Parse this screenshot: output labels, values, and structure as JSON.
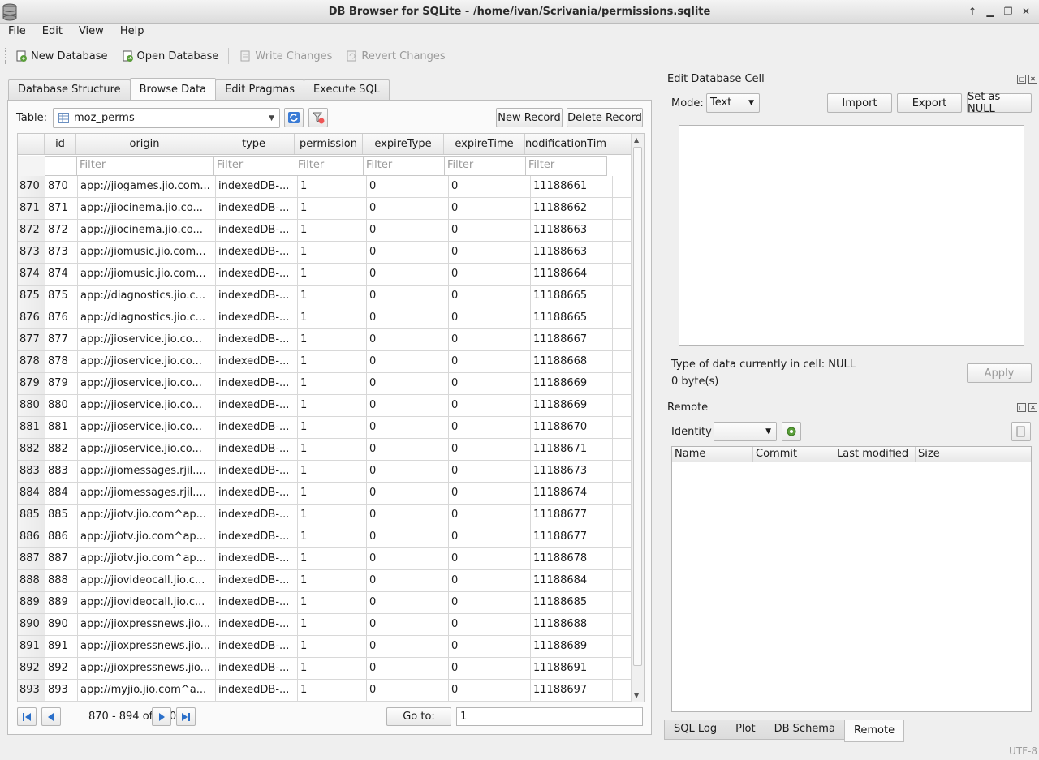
{
  "window": {
    "title": "DB Browser for SQLite - /home/ivan/Scrivania/permissions.sqlite"
  },
  "menu": [
    "File",
    "Edit",
    "View",
    "Help"
  ],
  "toolbar": {
    "new_db": "New Database",
    "open_db": "Open Database",
    "write": "Write Changes",
    "revert": "Revert Changes"
  },
  "tabs": [
    "Database Structure",
    "Browse Data",
    "Edit Pragmas",
    "Execute SQL"
  ],
  "browse": {
    "table_label": "Table:",
    "table_value": "moz_perms",
    "new_record": "New Record",
    "delete_record": "Delete Record",
    "columns": [
      "id",
      "origin",
      "type",
      "permission",
      "expireType",
      "expireTime",
      "nodificationTim"
    ],
    "filter_placeholder": "Filter",
    "rows": [
      [
        "870",
        "870",
        "app://jiogames.jio.com...",
        "indexedDB-...",
        "1",
        "0",
        "0",
        "11188661"
      ],
      [
        "871",
        "871",
        "app://jiocinema.jio.co...",
        "indexedDB-...",
        "1",
        "0",
        "0",
        "11188662"
      ],
      [
        "872",
        "872",
        "app://jiocinema.jio.co...",
        "indexedDB-...",
        "1",
        "0",
        "0",
        "11188663"
      ],
      [
        "873",
        "873",
        "app://jiomusic.jio.com...",
        "indexedDB-...",
        "1",
        "0",
        "0",
        "11188663"
      ],
      [
        "874",
        "874",
        "app://jiomusic.jio.com...",
        "indexedDB-...",
        "1",
        "0",
        "0",
        "11188664"
      ],
      [
        "875",
        "875",
        "app://diagnostics.jio.c...",
        "indexedDB-...",
        "1",
        "0",
        "0",
        "11188665"
      ],
      [
        "876",
        "876",
        "app://diagnostics.jio.c...",
        "indexedDB-...",
        "1",
        "0",
        "0",
        "11188665"
      ],
      [
        "877",
        "877",
        "app://jioservice.jio.co...",
        "indexedDB-...",
        "1",
        "0",
        "0",
        "11188667"
      ],
      [
        "878",
        "878",
        "app://jioservice.jio.co...",
        "indexedDB-...",
        "1",
        "0",
        "0",
        "11188668"
      ],
      [
        "879",
        "879",
        "app://jioservice.jio.co...",
        "indexedDB-...",
        "1",
        "0",
        "0",
        "11188669"
      ],
      [
        "880",
        "880",
        "app://jioservice.jio.co...",
        "indexedDB-...",
        "1",
        "0",
        "0",
        "11188669"
      ],
      [
        "881",
        "881",
        "app://jioservice.jio.co...",
        "indexedDB-...",
        "1",
        "0",
        "0",
        "11188670"
      ],
      [
        "882",
        "882",
        "app://jioservice.jio.co...",
        "indexedDB-...",
        "1",
        "0",
        "0",
        "11188671"
      ],
      [
        "883",
        "883",
        "app://jiomessages.rjil....",
        "indexedDB-...",
        "1",
        "0",
        "0",
        "11188673"
      ],
      [
        "884",
        "884",
        "app://jiomessages.rjil....",
        "indexedDB-...",
        "1",
        "0",
        "0",
        "11188674"
      ],
      [
        "885",
        "885",
        "app://jiotv.jio.com^ap...",
        "indexedDB-...",
        "1",
        "0",
        "0",
        "11188677"
      ],
      [
        "886",
        "886",
        "app://jiotv.jio.com^ap...",
        "indexedDB-...",
        "1",
        "0",
        "0",
        "11188677"
      ],
      [
        "887",
        "887",
        "app://jiotv.jio.com^ap...",
        "indexedDB-...",
        "1",
        "0",
        "0",
        "11188678"
      ],
      [
        "888",
        "888",
        "app://jiovideocall.jio.c...",
        "indexedDB-...",
        "1",
        "0",
        "0",
        "11188684"
      ],
      [
        "889",
        "889",
        "app://jiovideocall.jio.c...",
        "indexedDB-...",
        "1",
        "0",
        "0",
        "11188685"
      ],
      [
        "890",
        "890",
        "app://jioxpressnews.jio...",
        "indexedDB-...",
        "1",
        "0",
        "0",
        "11188688"
      ],
      [
        "891",
        "891",
        "app://jioxpressnews.jio...",
        "indexedDB-...",
        "1",
        "0",
        "0",
        "11188689"
      ],
      [
        "892",
        "892",
        "app://jioxpressnews.jio...",
        "indexedDB-...",
        "1",
        "0",
        "0",
        "11188691"
      ],
      [
        "893",
        "893",
        "app://myjio.jio.com^a...",
        "indexedDB-...",
        "1",
        "0",
        "0",
        "11188697"
      ]
    ],
    "page_info": "870 - 894 of 900",
    "goto_label": "Go to:",
    "goto_value": "1"
  },
  "edit_cell": {
    "title": "Edit Database Cell",
    "mode_label": "Mode:",
    "mode_value": "Text",
    "import": "Import",
    "export": "Export",
    "set_null": "Set as NULL",
    "type_info": "Type of data currently in cell: NULL",
    "size_info": "0 byte(s)",
    "apply": "Apply"
  },
  "remote": {
    "title": "Remote",
    "identity_label": "Identity",
    "columns": [
      "Name",
      "Commit",
      "Last modified",
      "Size"
    ]
  },
  "bottom_tabs": [
    "SQL Log",
    "Plot",
    "DB Schema",
    "Remote"
  ],
  "status": {
    "encoding": "UTF-8"
  }
}
